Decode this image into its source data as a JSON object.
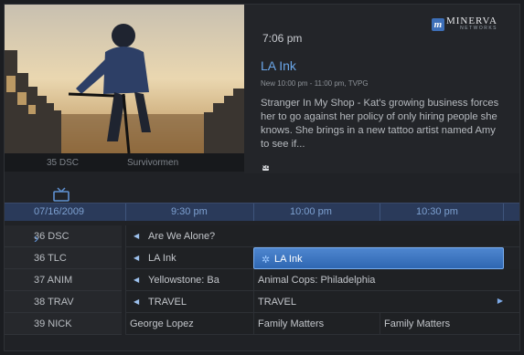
{
  "brand": {
    "logo_letter": "m",
    "name": "MINERVA",
    "sub": "NETWORKS"
  },
  "preview": {
    "channel": "35 DSC",
    "show": "Survivormen"
  },
  "info": {
    "time": "7:06 pm",
    "title": "LA Ink",
    "meta": "New 10:00 pm - 11:00 pm, TVPG",
    "description": "Stranger In My Shop - Kat's growing business forces her to go against her policy of only hiring people she knows. She brings in a new tattoo artist named Amy to see if...",
    "cc_label": "CC"
  },
  "guide": {
    "date": "07/16/2009",
    "times": [
      "9:30 pm",
      "10:00 pm",
      "10:30 pm"
    ],
    "rows": [
      {
        "channel": "36 DSC",
        "programs": [
          "Are We Alone?"
        ]
      },
      {
        "channel": "36 TLC",
        "programs": [
          "LA Ink",
          "LA Ink"
        ]
      },
      {
        "channel": "37 ANIM",
        "programs": [
          "Yellowstone: Ba",
          "Animal Cops: Philadelphia"
        ]
      },
      {
        "channel": "38 TRAV",
        "programs": [
          "TRAVEL",
          "TRAVEL"
        ]
      },
      {
        "channel": "39 NICK",
        "programs": [
          "George Lopez",
          "Family Matters",
          "Family Matters"
        ]
      }
    ]
  },
  "colors": {
    "accent": "#4e86cf",
    "title": "#6aa6e8",
    "header": "#2a3a5a"
  },
  "icons": [
    "tv-icon",
    "chevron-right-icon",
    "arrow-left-icon",
    "arrow-right-icon",
    "star-icon",
    "closed-caption-icon"
  ]
}
